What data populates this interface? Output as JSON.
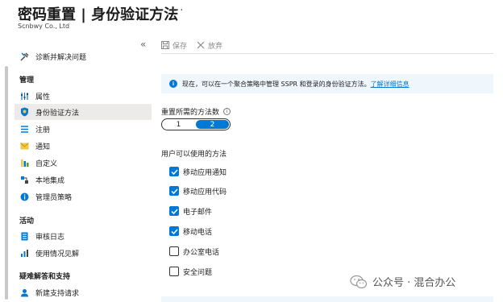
{
  "header": {
    "title": "密码重置 | 身份验证方法",
    "more": "···",
    "subtitle": "Scnbwy Co., Ltd"
  },
  "sidebar": {
    "collapse": "«",
    "top_item": {
      "label": "诊断并解决问题",
      "icon": "wrench-icon"
    },
    "sections": {
      "manage": "管理",
      "activity": "活动",
      "support": "疑难解答和支持"
    },
    "manage_items": [
      {
        "label": "属性",
        "icon": "properties-icon"
      },
      {
        "label": "身份验证方法",
        "icon": "shield-icon"
      },
      {
        "label": "注册",
        "icon": "register-icon"
      },
      {
        "label": "通知",
        "icon": "notification-icon"
      },
      {
        "label": "自定义",
        "icon": "customize-icon"
      },
      {
        "label": "本地集成",
        "icon": "integration-icon"
      },
      {
        "label": "管理员策略",
        "icon": "info-icon"
      }
    ],
    "activity_items": [
      {
        "label": "审核日志",
        "icon": "log-icon"
      },
      {
        "label": "使用情况见解",
        "icon": "insights-icon"
      }
    ],
    "support_items": [
      {
        "label": "新建支持请求",
        "icon": "support-icon"
      }
    ]
  },
  "toolbar": {
    "save": "保存",
    "discard": "放弃"
  },
  "info": {
    "text": "现在，可以在一个聚合策略中管理 SSPR 和登录的身份验证方法。",
    "link": "了解详细信息"
  },
  "methods_count": {
    "label": "重置所需的方法数",
    "options": [
      "1",
      "2"
    ],
    "selected": "2"
  },
  "methods": {
    "label": "用户可以使用的方法",
    "items": [
      {
        "label": "移动应用通知",
        "checked": true
      },
      {
        "label": "移动应用代码",
        "checked": true
      },
      {
        "label": "电子邮件",
        "checked": true
      },
      {
        "label": "移动电话",
        "checked": true
      },
      {
        "label": "办公室电话",
        "checked": false
      },
      {
        "label": "安全问题",
        "checked": false
      }
    ]
  },
  "watermark": {
    "text": "公众号 · 混合办公"
  },
  "colors": {
    "accent": "#0078d4",
    "active_bg": "#edebe9",
    "info_bg": "#eff6fc"
  }
}
